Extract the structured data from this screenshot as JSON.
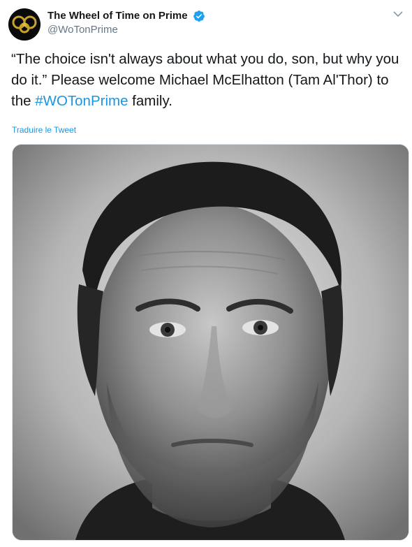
{
  "account": {
    "display_name": "The Wheel of Time on Prime",
    "handle": "@WoTonPrime",
    "verified": true
  },
  "tweet": {
    "text_before": "“The choice isn't always about what you do, son, but why you do it.” Please welcome Michael McElhatton (Tam Al'Thor) to the ",
    "hashtag": "#WOTonPrime",
    "text_after": " family.",
    "translate_label": "Traduire le Tweet"
  },
  "media": {
    "type": "photo",
    "subject": "black-and-white portrait"
  },
  "icons": {
    "verified": "verified-badge-icon",
    "menu": "chevron-down-icon"
  },
  "colors": {
    "link": "#1b95e0",
    "verified": "#1da1f2",
    "text": "#14171a",
    "secondary": "#657786"
  }
}
